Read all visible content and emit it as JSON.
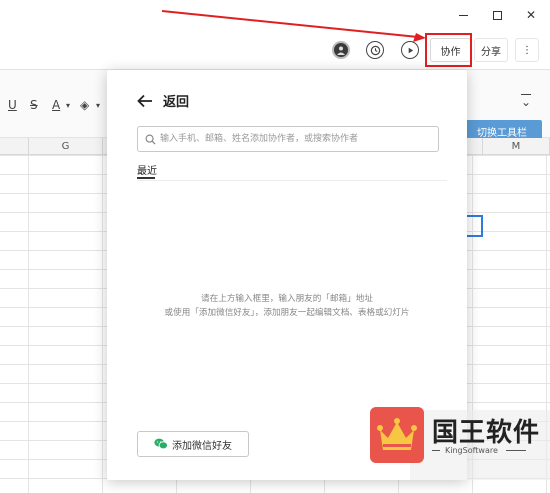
{
  "window": {
    "minimize_icon": "minimize-icon",
    "maximize_icon": "maximize-icon",
    "close_icon": "close-icon",
    "close_glyph": "✕"
  },
  "header": {
    "collab_label": "协作",
    "share_label": "分享",
    "more_glyph": "⋮"
  },
  "toolbar": {
    "underline": "U",
    "strike": "S",
    "font_color": "A",
    "fill": "◈",
    "caret": "▾",
    "collapse": "⌄",
    "tooltip": "切换工具栏"
  },
  "sheet": {
    "col_g": "G",
    "col_m": "M"
  },
  "dialog": {
    "back_label": "返回",
    "search_placeholder": "输入手机、邮箱、姓名添加协作者，或搜索协作者",
    "tab_recent": "最近",
    "hint_line1": "请在上方输入框里，输入朋友的「邮箱」地址",
    "hint_line2": "或使用「添加微信好友」，添加朋友一起编辑文档、表格或幻灯片",
    "wechat_button": "添加微信好友"
  },
  "watermark": {
    "title": "国王软件",
    "subtitle": "KingSoftware"
  },
  "colors": {
    "annotation_red": "#e02020",
    "tip_blue": "#5b9bd5",
    "wechat_green": "#2aae67",
    "logo_red": "#e9554a",
    "crown_yellow": "#f7c744"
  }
}
